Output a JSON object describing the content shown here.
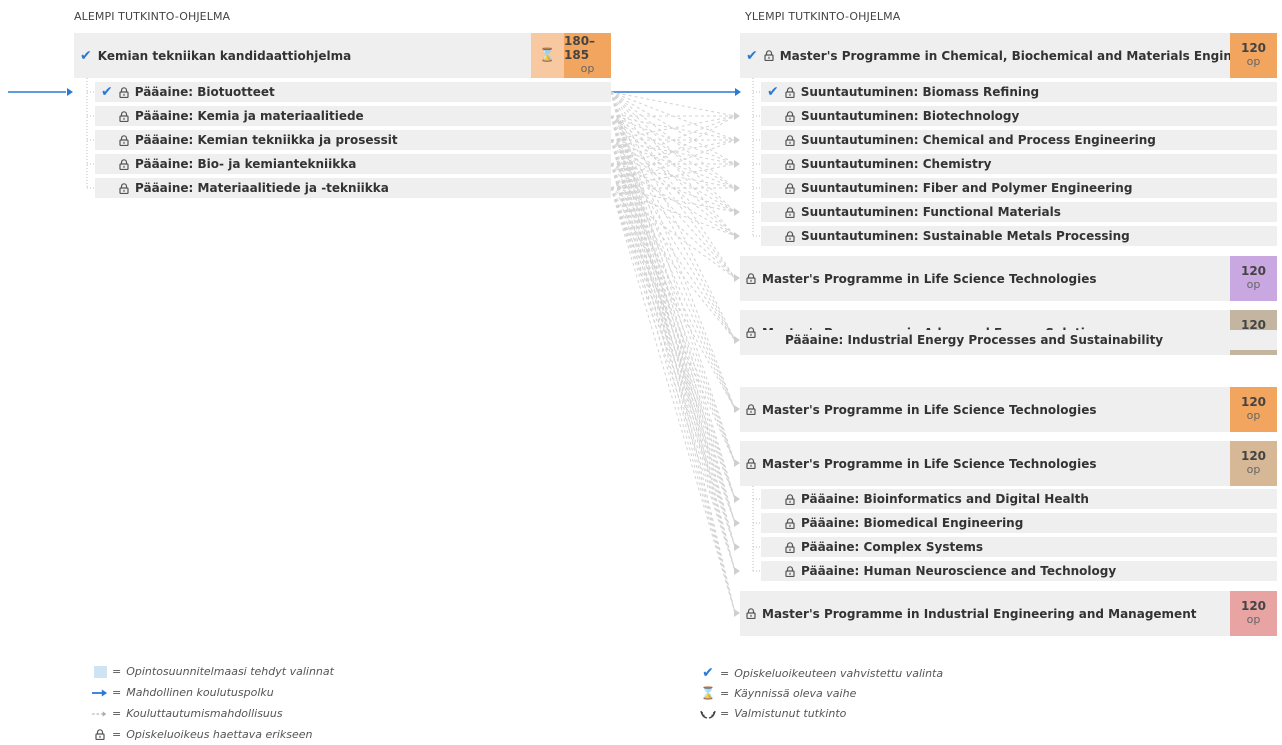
{
  "left_title": "ALEMPI TUTKINTO-OHJELMA",
  "right_title": "YLEMPI TUTKINTO-OHJELMA",
  "bachelor": {
    "title": "Kemian tekniikan kandidaattiohjelma",
    "credits": "180–185",
    "unit": "op",
    "majors": [
      "Pääaine: Biotuotteet",
      "Pääaine: Kemia ja materiaalitiede",
      "Pääaine: Kemian tekniikka ja prosessit",
      "Pääaine: Bio- ja kemiantekniikka",
      "Pääaine: Materiaalitiede ja -tekniikka"
    ]
  },
  "masters": [
    {
      "title": "Master's Programme in Chemical, Biochemical and Materials Engineering",
      "credits": "120",
      "unit": "op",
      "color": "#f2a55f",
      "subs": [
        "Suuntautuminen: Biomass Refining",
        "Suuntautuminen: Biotechnology",
        "Suuntautuminen: Chemical and Process Engineering",
        "Suuntautuminen: Chemistry",
        "Suuntautuminen: Fiber and Polymer Engineering",
        "Suuntautuminen: Functional Materials",
        "Suuntautuminen: Sustainable Metals Processing"
      ]
    },
    {
      "title": "Master's Programme in Life Science Technologies",
      "credits": "120",
      "unit": "op",
      "color": "#c9a7e0",
      "subs": []
    },
    {
      "title": "Master's Programme in Advanced Energy Solutions",
      "credits": "120",
      "unit": "op",
      "color": "#c3b5a0",
      "subs": [
        "Pääaine: Industrial Energy Processes and Sustainability"
      ]
    },
    {
      "title": "Master's Programme in Life Science Technologies",
      "credits": "120",
      "unit": "op",
      "color": "#f2a55f",
      "subs": []
    },
    {
      "title": "Master's Programme in Life Science Technologies",
      "credits": "120",
      "unit": "op",
      "color": "#d6b896",
      "subs": [
        "Pääaine: Bioinformatics and Digital Health",
        "Pääaine: Biomedical Engineering",
        "Pääaine: Complex Systems",
        "Pääaine: Human Neuroscience and Technology"
      ]
    },
    {
      "title": "Master's Programme in Industrial Engineering and Management",
      "credits": "120",
      "unit": "op",
      "color": "#e8a3a3",
      "subs": []
    }
  ],
  "legend": {
    "selections": "Opintosuunnitelmaasi tehdyt valinnat",
    "path": "Mahdollinen koulutuspolku",
    "possibility": "Kouluttautumismahdollisuus",
    "apply": "Opiskeluoikeus haettava erikseen",
    "confirmed": "Opiskeluoikeuteen vahvistettu valinta",
    "ongoing": "Käynnissä oleva vaihe",
    "graduated": "Valmistunut tutkinto"
  }
}
